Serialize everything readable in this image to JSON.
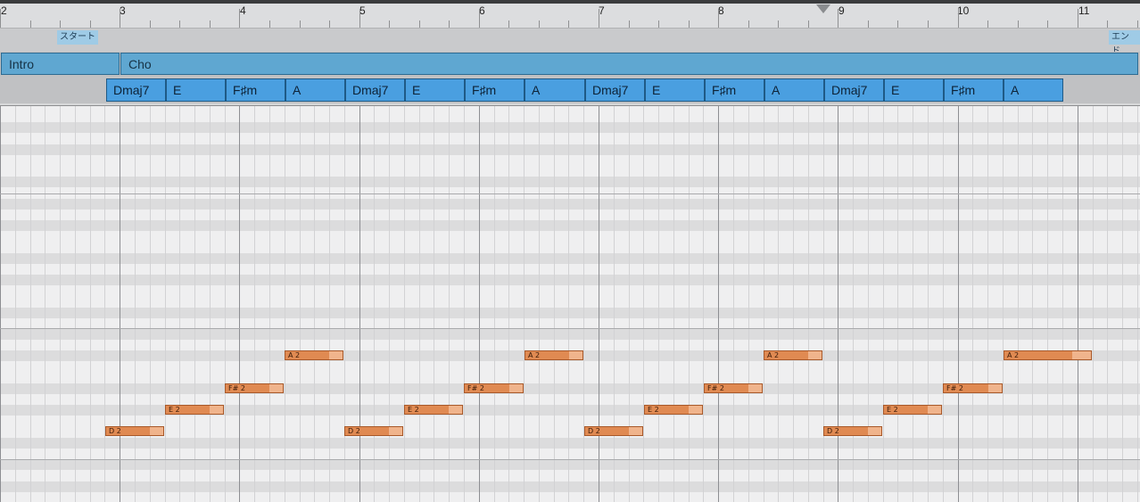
{
  "ruler": {
    "bars": [
      "2",
      "3",
      "4",
      "5",
      "6",
      "7",
      "8",
      "9",
      "10",
      "11"
    ]
  },
  "markers": {
    "start": "スタート",
    "end": "エンド"
  },
  "sections": [
    "Intro",
    "Cho"
  ],
  "chords": [
    "Dmaj7",
    "E",
    "F♯m",
    "A",
    "Dmaj7",
    "E",
    "F♯m",
    "A",
    "Dmaj7",
    "E",
    "F♯m",
    "A",
    "Dmaj7",
    "E",
    "F♯m",
    "A"
  ],
  "notes": [
    "D 2",
    "E 2",
    "F# 2",
    "A 2",
    "D 2",
    "E 2",
    "F# 2",
    "A 2",
    "D 2",
    "E 2",
    "F# 2",
    "A 2",
    "D 2",
    "E 2",
    "F# 2",
    "A 2"
  ]
}
